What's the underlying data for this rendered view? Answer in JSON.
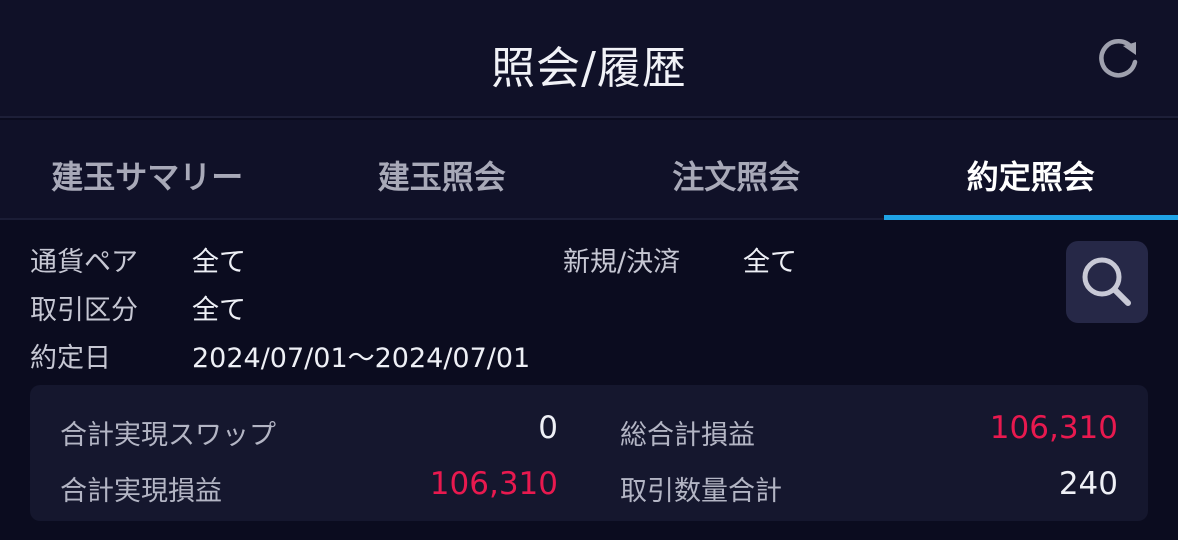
{
  "header": {
    "title": "照会/履歴",
    "refresh_icon": "refresh-icon"
  },
  "tabs": [
    {
      "label": "建玉サマリー",
      "active": false
    },
    {
      "label": "建玉照会",
      "active": false
    },
    {
      "label": "注文照会",
      "active": false
    },
    {
      "label": "約定照会",
      "active": true
    }
  ],
  "filters": {
    "currency_pair": {
      "label": "通貨ペア",
      "value": "全て"
    },
    "new_settle": {
      "label": "新規/決済",
      "value": "全て"
    },
    "trade_type": {
      "label": "取引区分",
      "value": "全て"
    },
    "execution_date": {
      "label": "約定日",
      "value": "2024/07/01～2024/07/01"
    },
    "search_icon": "search-icon"
  },
  "summary": {
    "total_swap": {
      "label": "合計実現スワップ",
      "value": "0"
    },
    "total_realized_pl": {
      "label": "合計実現損益",
      "value": "106,310"
    },
    "grand_total_pl": {
      "label": "総合計損益",
      "value": "106,310"
    },
    "total_quantity": {
      "label": "取引数量合計",
      "value": "240"
    }
  },
  "colors": {
    "accent": "#1fa3e6",
    "profit": "#e8194f",
    "background": "#0b0c1f",
    "header_bg": "#101128"
  }
}
